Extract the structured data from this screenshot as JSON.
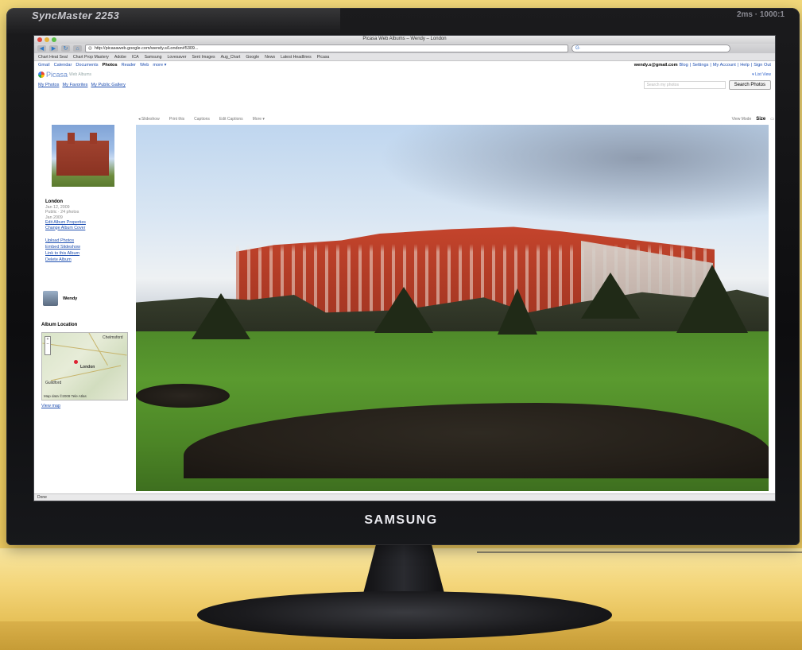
{
  "monitor": {
    "model": "SyncMaster 2253",
    "brand": "SAMSUNG"
  },
  "browser": {
    "window_title": "Picasa Web Albums – Wendy – London",
    "url": "http://picasaweb.google.com/wendy.s/London#5309...",
    "search_engine": "G·",
    "bookmarks": [
      "Chart Heat Seal",
      "Chart Prop Mastery",
      "Adobe",
      "ICA",
      "Samsung",
      "Lovesaver",
      "Sent Images",
      "Aug_Chart",
      "Google",
      "News",
      "Latest Headlines",
      "Picasa"
    ],
    "status": "Done"
  },
  "google_bar": {
    "links": [
      "Gmail",
      "Calendar",
      "Documents",
      "Photos",
      "Reader",
      "Web",
      "more ▾"
    ],
    "active_link": "Photos",
    "account": "wendy.s@gmail.com",
    "account_links": [
      "Blog",
      "Settings",
      "My Account",
      "Help",
      "Sign Out"
    ]
  },
  "picasa": {
    "logo_text": "Picasa",
    "logo_sub": "Web Albums",
    "list_view": "▾ List View",
    "nav_links": [
      "My Photos",
      "My Favorites",
      "My Public Gallery"
    ],
    "search_placeholder": "Search my photos",
    "search_button": "Search Photos"
  },
  "album": {
    "title": "London",
    "subtitle_lines": [
      "Jan 12, 2009",
      "Public · 24 photos",
      "Jan 2009"
    ],
    "links": [
      "Edit Album Properties",
      "Change Album Cover"
    ],
    "actions": [
      "Upload Photos",
      "Embed Slideshow",
      "Link to this Album",
      "Delete Album"
    ],
    "owner": "Wendy",
    "location_title": "Album Location",
    "map_labels": [
      "Chelmsford",
      "London",
      "Guildford"
    ],
    "map_copyright": "Map data ©2009 Tele Atlas",
    "view_map": "View map"
  },
  "photo_tools": {
    "left": [
      "◂ Slideshow",
      "Print this",
      "Captions",
      "Edit Captions",
      "More ▾"
    ],
    "view_mode": "View Mode",
    "size_label": "Size"
  },
  "colors": {
    "link": "#1f4fb0",
    "wall": "#f3d46a",
    "bezel": "#111113"
  }
}
